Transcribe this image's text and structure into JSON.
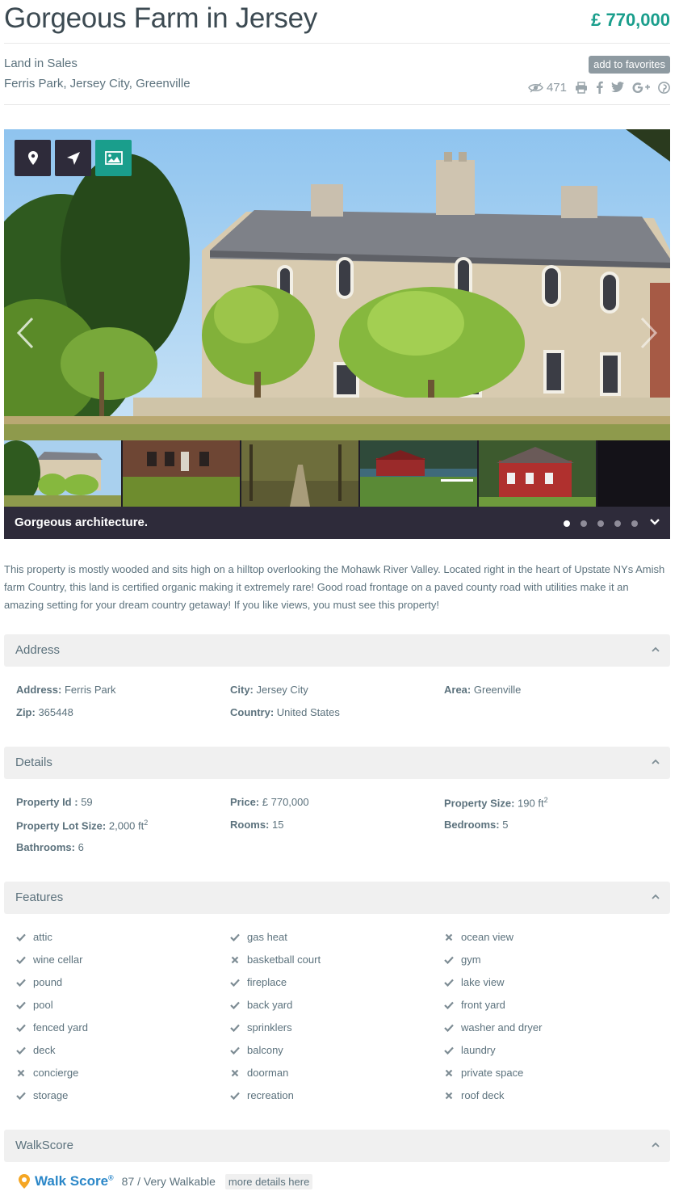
{
  "header": {
    "title": "Gorgeous Farm in Jersey",
    "price": "£ 770,000",
    "category": "Land in Sales",
    "location": "Ferris Park, Jersey City, Greenville",
    "favorites_label": "add to favorites",
    "views": "471"
  },
  "gallery": {
    "caption": "Gorgeous architecture.",
    "dot_count": 5,
    "active_dot": 1,
    "buttons": [
      "map-pin-icon",
      "navigation-icon",
      "image-icon"
    ],
    "accent_color": "#1a9e8c"
  },
  "description": "This property is mostly wooded and sits high on a hilltop overlooking the Mohawk River Valley. Located right in the heart of Upstate NYs Amish farm Country, this land is certified organic making it extremely rare! Good road frontage on a paved county road with utilities make it an amazing setting for your dream country getaway! If you like views, you must see this property!",
  "address": {
    "title": "Address",
    "address_label": "Address:",
    "address_value": "Ferris Park",
    "city_label": "City:",
    "city_value": "Jersey City",
    "area_label": "Area:",
    "area_value": "Greenville",
    "zip_label": "Zip:",
    "zip_value": "365448",
    "country_label": "Country:",
    "country_value": "United States"
  },
  "details": {
    "title": "Details",
    "id_label": "Property Id :",
    "id_value": "59",
    "price_label": "Price:",
    "price_value": "£ 770,000",
    "size_label": "Property Size:",
    "size_value": "190 ft",
    "lot_label": "Property Lot Size:",
    "lot_value": "2,000 ft",
    "rooms_label": "Rooms:",
    "rooms_value": "15",
    "bedrooms_label": "Bedrooms:",
    "bedrooms_value": "5",
    "bathrooms_label": "Bathrooms:",
    "bathrooms_value": "6",
    "sup": "2"
  },
  "features": {
    "title": "Features",
    "col1": [
      {
        "label": "attic",
        "has": true
      },
      {
        "label": "wine cellar",
        "has": true
      },
      {
        "label": "pound",
        "has": true
      },
      {
        "label": "pool",
        "has": true
      },
      {
        "label": "fenced yard",
        "has": true
      },
      {
        "label": "deck",
        "has": true
      },
      {
        "label": "concierge",
        "has": false
      },
      {
        "label": "storage",
        "has": true
      }
    ],
    "col2": [
      {
        "label": "gas heat",
        "has": true
      },
      {
        "label": "basketball court",
        "has": false
      },
      {
        "label": "fireplace",
        "has": true
      },
      {
        "label": "back yard",
        "has": true
      },
      {
        "label": "sprinklers",
        "has": true
      },
      {
        "label": "balcony",
        "has": true
      },
      {
        "label": "doorman",
        "has": false
      },
      {
        "label": "recreation",
        "has": true
      }
    ],
    "col3": [
      {
        "label": "ocean view",
        "has": false
      },
      {
        "label": "gym",
        "has": true
      },
      {
        "label": "lake view",
        "has": true
      },
      {
        "label": "front yard",
        "has": true
      },
      {
        "label": "washer and dryer",
        "has": true
      },
      {
        "label": "laundry",
        "has": true
      },
      {
        "label": "private space",
        "has": false
      },
      {
        "label": "roof deck",
        "has": false
      }
    ]
  },
  "walkscore": {
    "title": "WalkScore",
    "logo_text": "Walk Score",
    "registered": "®",
    "score": "87 / Very Walkable",
    "more_label": "more details here"
  }
}
